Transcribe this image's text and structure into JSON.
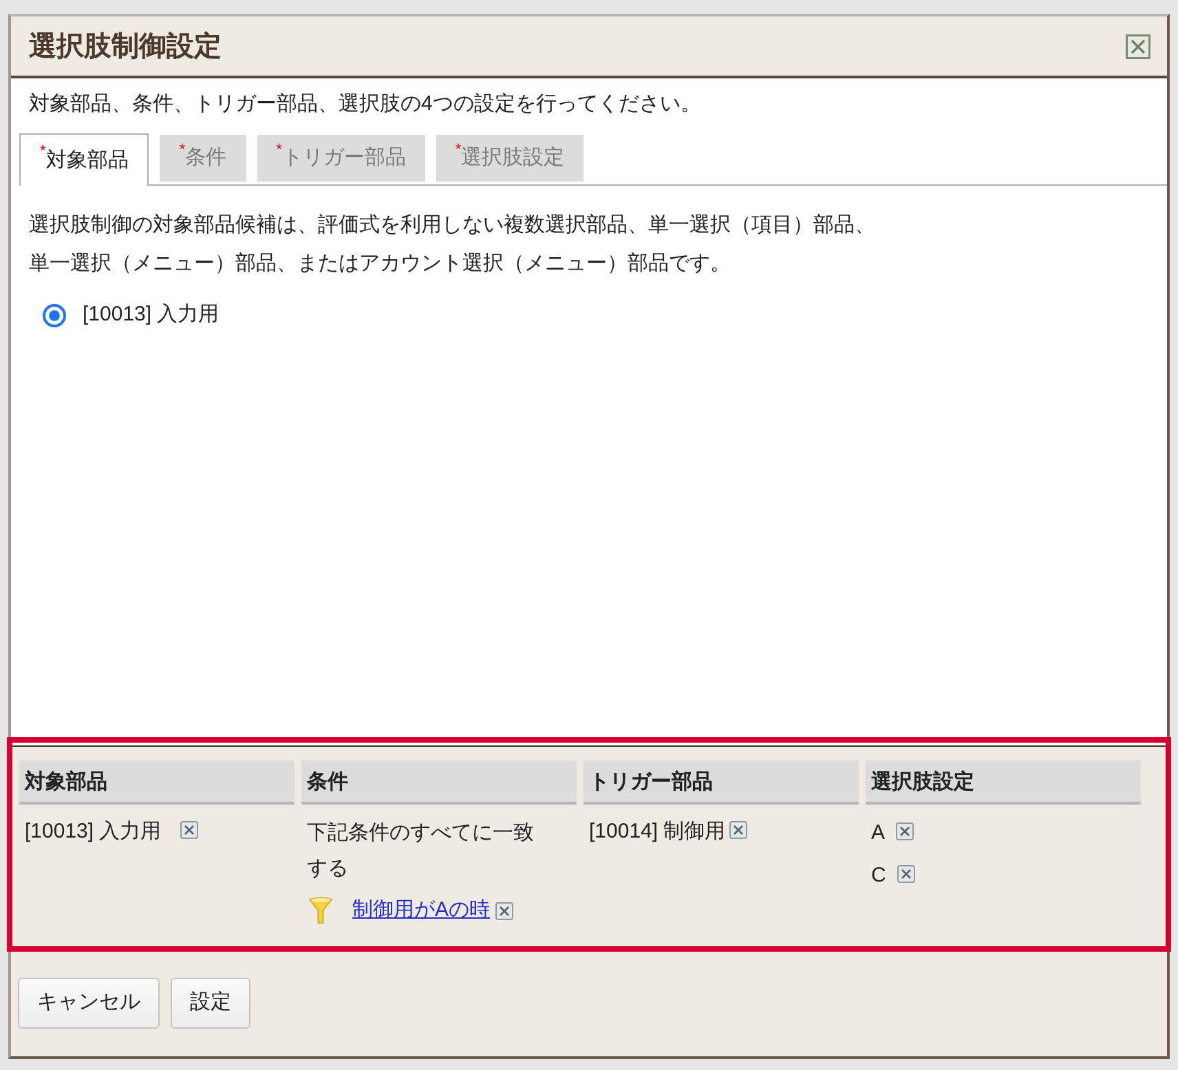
{
  "dialog": {
    "title": "選択肢制御設定"
  },
  "instruction": "対象部品、条件、トリガー部品、選択肢の4つの設定を行ってください。",
  "tabs": [
    {
      "required_mark": "*",
      "label": "対象部品",
      "selected": true
    },
    {
      "required_mark": "*",
      "label": "条件",
      "selected": false
    },
    {
      "required_mark": "*",
      "label": "トリガー部品",
      "selected": false
    },
    {
      "required_mark": "*",
      "label": "選択肢設定",
      "selected": false
    }
  ],
  "panel": {
    "description": [
      "選択肢制御の対象部品候補は、評価式を利用しない複数選択部品、単一選択（項目）部品、",
      "単一選択（メニュー）部品、またはアカウント選択（メニュー）部品です。"
    ],
    "options": [
      {
        "label": "[10013] 入力用",
        "selected": true
      }
    ]
  },
  "summary": {
    "highlighted": true,
    "columns": [
      "対象部品",
      "条件",
      "トリガー部品",
      "選択肢設定"
    ],
    "target": {
      "label": "[10013] 入力用"
    },
    "condition": {
      "text": "下記条件のすべてに一致する",
      "rules": [
        {
          "label": "制御用がAの時"
        }
      ]
    },
    "trigger": {
      "label": "[10014] 制御用"
    },
    "choices": [
      {
        "label": "A"
      },
      {
        "label": "C"
      }
    ]
  },
  "buttons": [
    "キャンセル",
    "設定"
  ]
}
